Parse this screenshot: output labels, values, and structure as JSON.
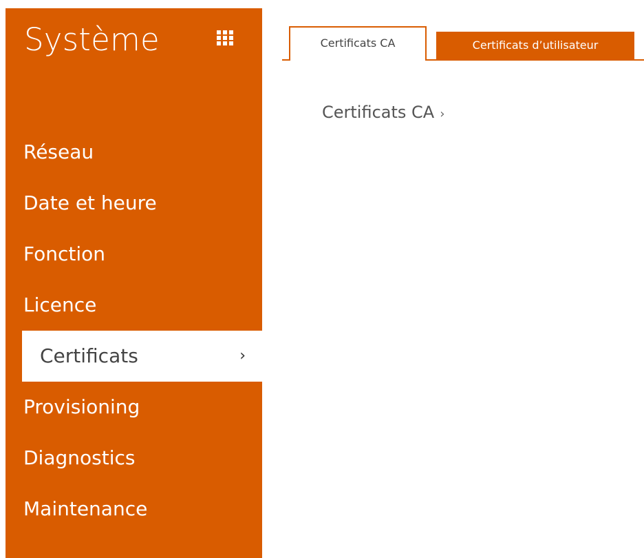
{
  "sidebar": {
    "title": "Système",
    "grid_icon": "grid-icon",
    "items": [
      {
        "label": "Réseau"
      },
      {
        "label": "Date et heure"
      },
      {
        "label": "Fonction"
      },
      {
        "label": "Licence"
      },
      {
        "label": "Certificats",
        "active": true,
        "chevron": "›"
      },
      {
        "label": "Provisioning"
      },
      {
        "label": "Diagnostics"
      },
      {
        "label": "Maintenance"
      }
    ]
  },
  "tabs": [
    {
      "label": "Certificats CA",
      "active": true
    },
    {
      "label": "Certificats d’utilisateur",
      "active": false
    }
  ],
  "main": {
    "section_label": "Certificats CA",
    "section_chevron": "›"
  },
  "colors": {
    "accent": "#d95c00",
    "text_dark": "#444444"
  }
}
